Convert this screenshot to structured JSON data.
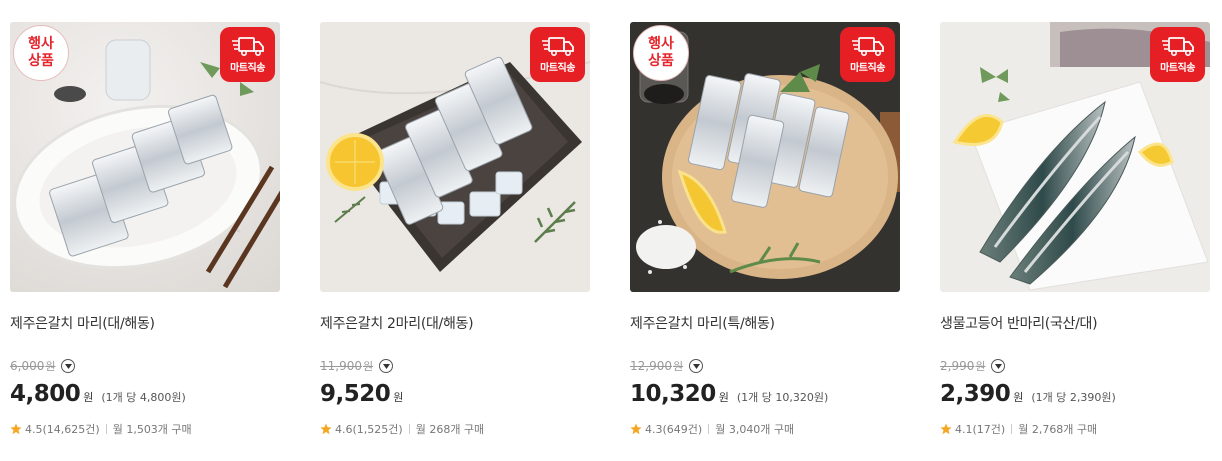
{
  "colors": {
    "accent_red": "#e61f25",
    "star": "#f5a623",
    "text": "#333333"
  },
  "products": [
    {
      "name": "제주은갈치 마리(대/해동)",
      "event_badge": true,
      "event_label_1": "행사",
      "event_label_2": "상품",
      "mart_label": "마트직송",
      "original_price": "6,000",
      "original_unit": "원",
      "price": "4,800",
      "price_unit": "원",
      "unit_price": "(1개 당 4,800원)",
      "rating": "4.5",
      "reviews": "(14,625건)",
      "purchases": "월 1,503개 구매"
    },
    {
      "name": "제주은갈치 2마리(대/해동)",
      "event_badge": false,
      "event_label_1": "",
      "event_label_2": "",
      "mart_label": "마트직송",
      "original_price": "11,900",
      "original_unit": "원",
      "price": "9,520",
      "price_unit": "원",
      "unit_price": "",
      "rating": "4.6",
      "reviews": "(1,525건)",
      "purchases": "월 268개 구매"
    },
    {
      "name": "제주은갈치 마리(특/해동)",
      "event_badge": true,
      "event_label_1": "행사",
      "event_label_2": "상품",
      "mart_label": "마트직송",
      "original_price": "12,900",
      "original_unit": "원",
      "price": "10,320",
      "price_unit": "원",
      "unit_price": "(1개 당 10,320원)",
      "rating": "4.3",
      "reviews": "(649건)",
      "purchases": "월 3,040개 구매"
    },
    {
      "name": "생물고등어 반마리(국산/대)",
      "event_badge": false,
      "event_label_1": "",
      "event_label_2": "",
      "mart_label": "마트직송",
      "original_price": "2,990",
      "original_unit": "원",
      "price": "2,390",
      "price_unit": "원",
      "unit_price": "(1개 당 2,390원)",
      "rating": "4.1",
      "reviews": "(17건)",
      "purchases": "월 2,768개 구매"
    }
  ]
}
